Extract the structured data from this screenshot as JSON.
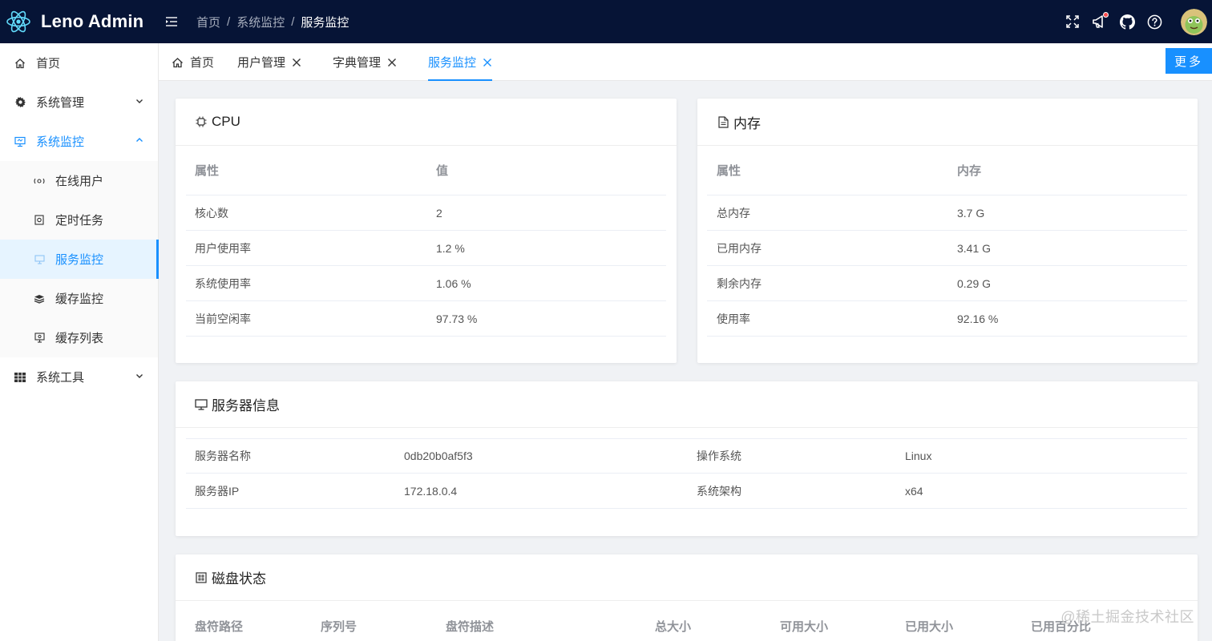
{
  "app": {
    "name": "Leno Admin"
  },
  "breadcrumb": [
    "首页",
    "系统监控",
    "服务监控"
  ],
  "sidebar": {
    "items": [
      {
        "label": "首页",
        "icon": "home-icon"
      },
      {
        "label": "系统管理",
        "icon": "gear-icon"
      },
      {
        "label": "系统监控",
        "icon": "monitor-icon"
      },
      {
        "label": "在线用户",
        "icon": "online-user-icon"
      },
      {
        "label": "定时任务",
        "icon": "job-icon"
      },
      {
        "label": "服务监控",
        "icon": "server-icon"
      },
      {
        "label": "缓存监控",
        "icon": "cache-icon"
      },
      {
        "label": "缓存列表",
        "icon": "cache-list-icon"
      },
      {
        "label": "系统工具",
        "icon": "tool-icon"
      }
    ]
  },
  "tabs": [
    {
      "label": "首页"
    },
    {
      "label": "用户管理"
    },
    {
      "label": "字典管理"
    },
    {
      "label": "服务监控"
    }
  ],
  "more_label": "更多",
  "cpu": {
    "title": "CPU",
    "headers": [
      "属性",
      "值"
    ],
    "rows": [
      [
        "核心数",
        "2"
      ],
      [
        "用户使用率",
        "1.2 %"
      ],
      [
        "系统使用率",
        "1.06 %"
      ],
      [
        "当前空闲率",
        "97.73 %"
      ]
    ]
  },
  "mem": {
    "title": "内存",
    "headers": [
      "属性",
      "内存"
    ],
    "rows": [
      [
        "总内存",
        "3.7 G"
      ],
      [
        "已用内存",
        "3.41 G"
      ],
      [
        "剩余内存",
        "0.29 G"
      ],
      [
        "使用率",
        "92.16 %"
      ]
    ]
  },
  "server": {
    "title": "服务器信息",
    "rows": [
      [
        "服务器名称",
        "0db20b0af5f3",
        "操作系统",
        "Linux"
      ],
      [
        "服务器IP",
        "172.18.0.4",
        "系统架构",
        "x64"
      ]
    ]
  },
  "disk": {
    "title": "磁盘状态",
    "headers": [
      "盘符路径",
      "序列号",
      "盘符描述",
      "总大小",
      "可用大小",
      "已用大小",
      "已用百分比"
    ]
  },
  "watermark": "@稀土掘金技术社区",
  "colors": {
    "header_bg": "#061436",
    "accent": "#1890ff"
  }
}
